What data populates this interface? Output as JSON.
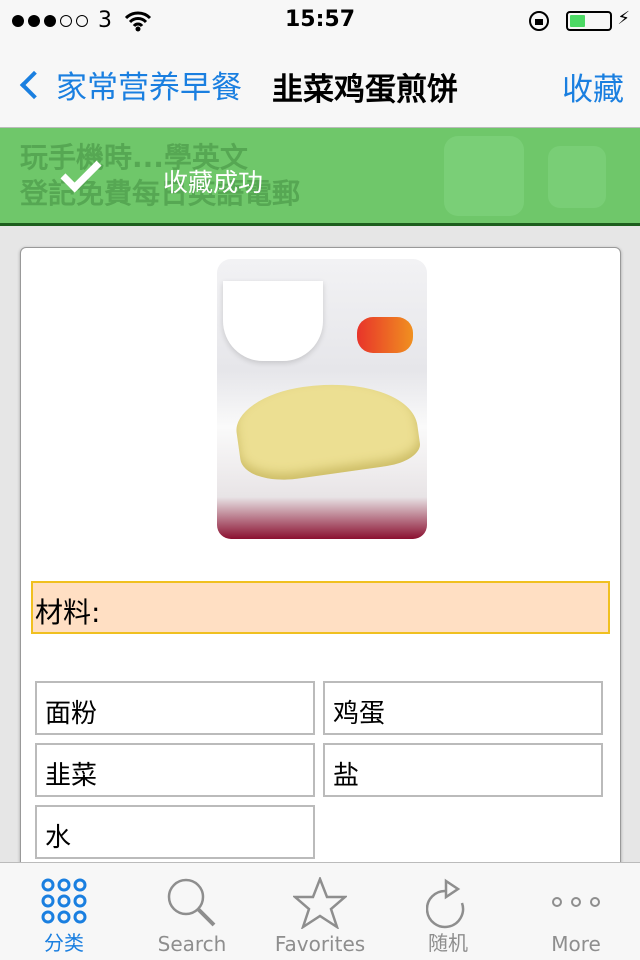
{
  "status": {
    "carrier": "3",
    "time": "15:57",
    "signal_bars": 3,
    "signal_total": 5,
    "battery_percent": 35
  },
  "nav": {
    "back_label": "家常营养早餐",
    "title": "韭菜鸡蛋煎饼",
    "favorite_label": "收藏"
  },
  "ad": {
    "line1": "玩手機時...學英文",
    "line2": "登記免費每日英語電郵"
  },
  "toast": {
    "message": "收藏成功",
    "icon": "checkmark-icon"
  },
  "recipe": {
    "section_title": "材料:",
    "ingredients": [
      "面粉",
      "鸡蛋",
      "韭菜",
      "盐",
      "水"
    ]
  },
  "tabbar": {
    "active": "分类",
    "accent": "#1a7fe0",
    "items": [
      {
        "label": "分类",
        "icon": "grid-icon"
      },
      {
        "label": "Search",
        "icon": "search-icon"
      },
      {
        "label": "Favorites",
        "icon": "star-icon"
      },
      {
        "label": "随机",
        "icon": "refresh-icon"
      },
      {
        "label": "More",
        "icon": "more-icon"
      }
    ]
  }
}
